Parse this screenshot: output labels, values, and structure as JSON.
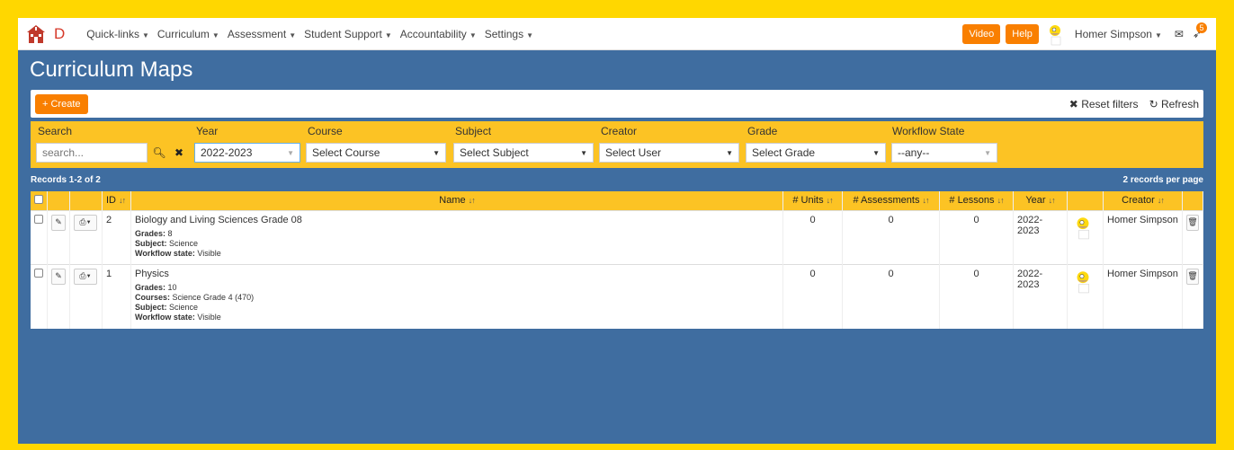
{
  "brand": {
    "letter": "D"
  },
  "nav": {
    "items": [
      "Quick-links",
      "Curriculum",
      "Assessment",
      "Student Support",
      "Accountability",
      "Settings"
    ],
    "video_label": "Video",
    "help_label": "Help",
    "user": "Homer Simpson",
    "notification_count": "5"
  },
  "page": {
    "title": "Curriculum Maps"
  },
  "toolbar": {
    "create_label": "+ Create",
    "reset_label": "Reset filters",
    "refresh_label": "Refresh"
  },
  "filters": {
    "search_label": "Search",
    "search_placeholder": "search...",
    "year_label": "Year",
    "year_value": "2022-2023",
    "course_label": "Course",
    "course_value": "Select Course",
    "subject_label": "Subject",
    "subject_value": "Select Subject",
    "creator_label": "Creator",
    "creator_value": "Select User",
    "grade_label": "Grade",
    "grade_value": "Select Grade",
    "workflow_label": "Workflow State",
    "workflow_value": "--any--"
  },
  "records": {
    "summary": "Records 1-2 of 2",
    "per_page": "2 records per page"
  },
  "table": {
    "headers": {
      "id": "ID",
      "name": "Name",
      "units": "# Units",
      "assessments": "# Assessments",
      "lessons": "# Lessons",
      "year": "Year",
      "creator": "Creator"
    },
    "rows": [
      {
        "id": "2",
        "name": "Biology and Living Sciences Grade 08",
        "grades_label": "Grades:",
        "grades": "8",
        "courses_label": "",
        "courses": "",
        "subject_label": "Subject:",
        "subject": "Science",
        "workflow_label": "Workflow state:",
        "workflow": "Visible",
        "units": "0",
        "assessments": "0",
        "lessons": "0",
        "year": "2022-2023",
        "creator": "Homer Simpson"
      },
      {
        "id": "1",
        "name": "Physics",
        "grades_label": "Grades:",
        "grades": "10",
        "courses_label": "Courses:",
        "courses": "Science Grade 4 (470)",
        "subject_label": "Subject:",
        "subject": "Science",
        "workflow_label": "Workflow state:",
        "workflow": "Visible",
        "units": "0",
        "assessments": "0",
        "lessons": "0",
        "year": "2022-2023",
        "creator": "Homer Simpson"
      }
    ]
  },
  "colors": {
    "page_bg": "#3f6da0",
    "accent": "#f97f00",
    "filter_bg": "#fcc324",
    "frame": "#ffd700"
  }
}
